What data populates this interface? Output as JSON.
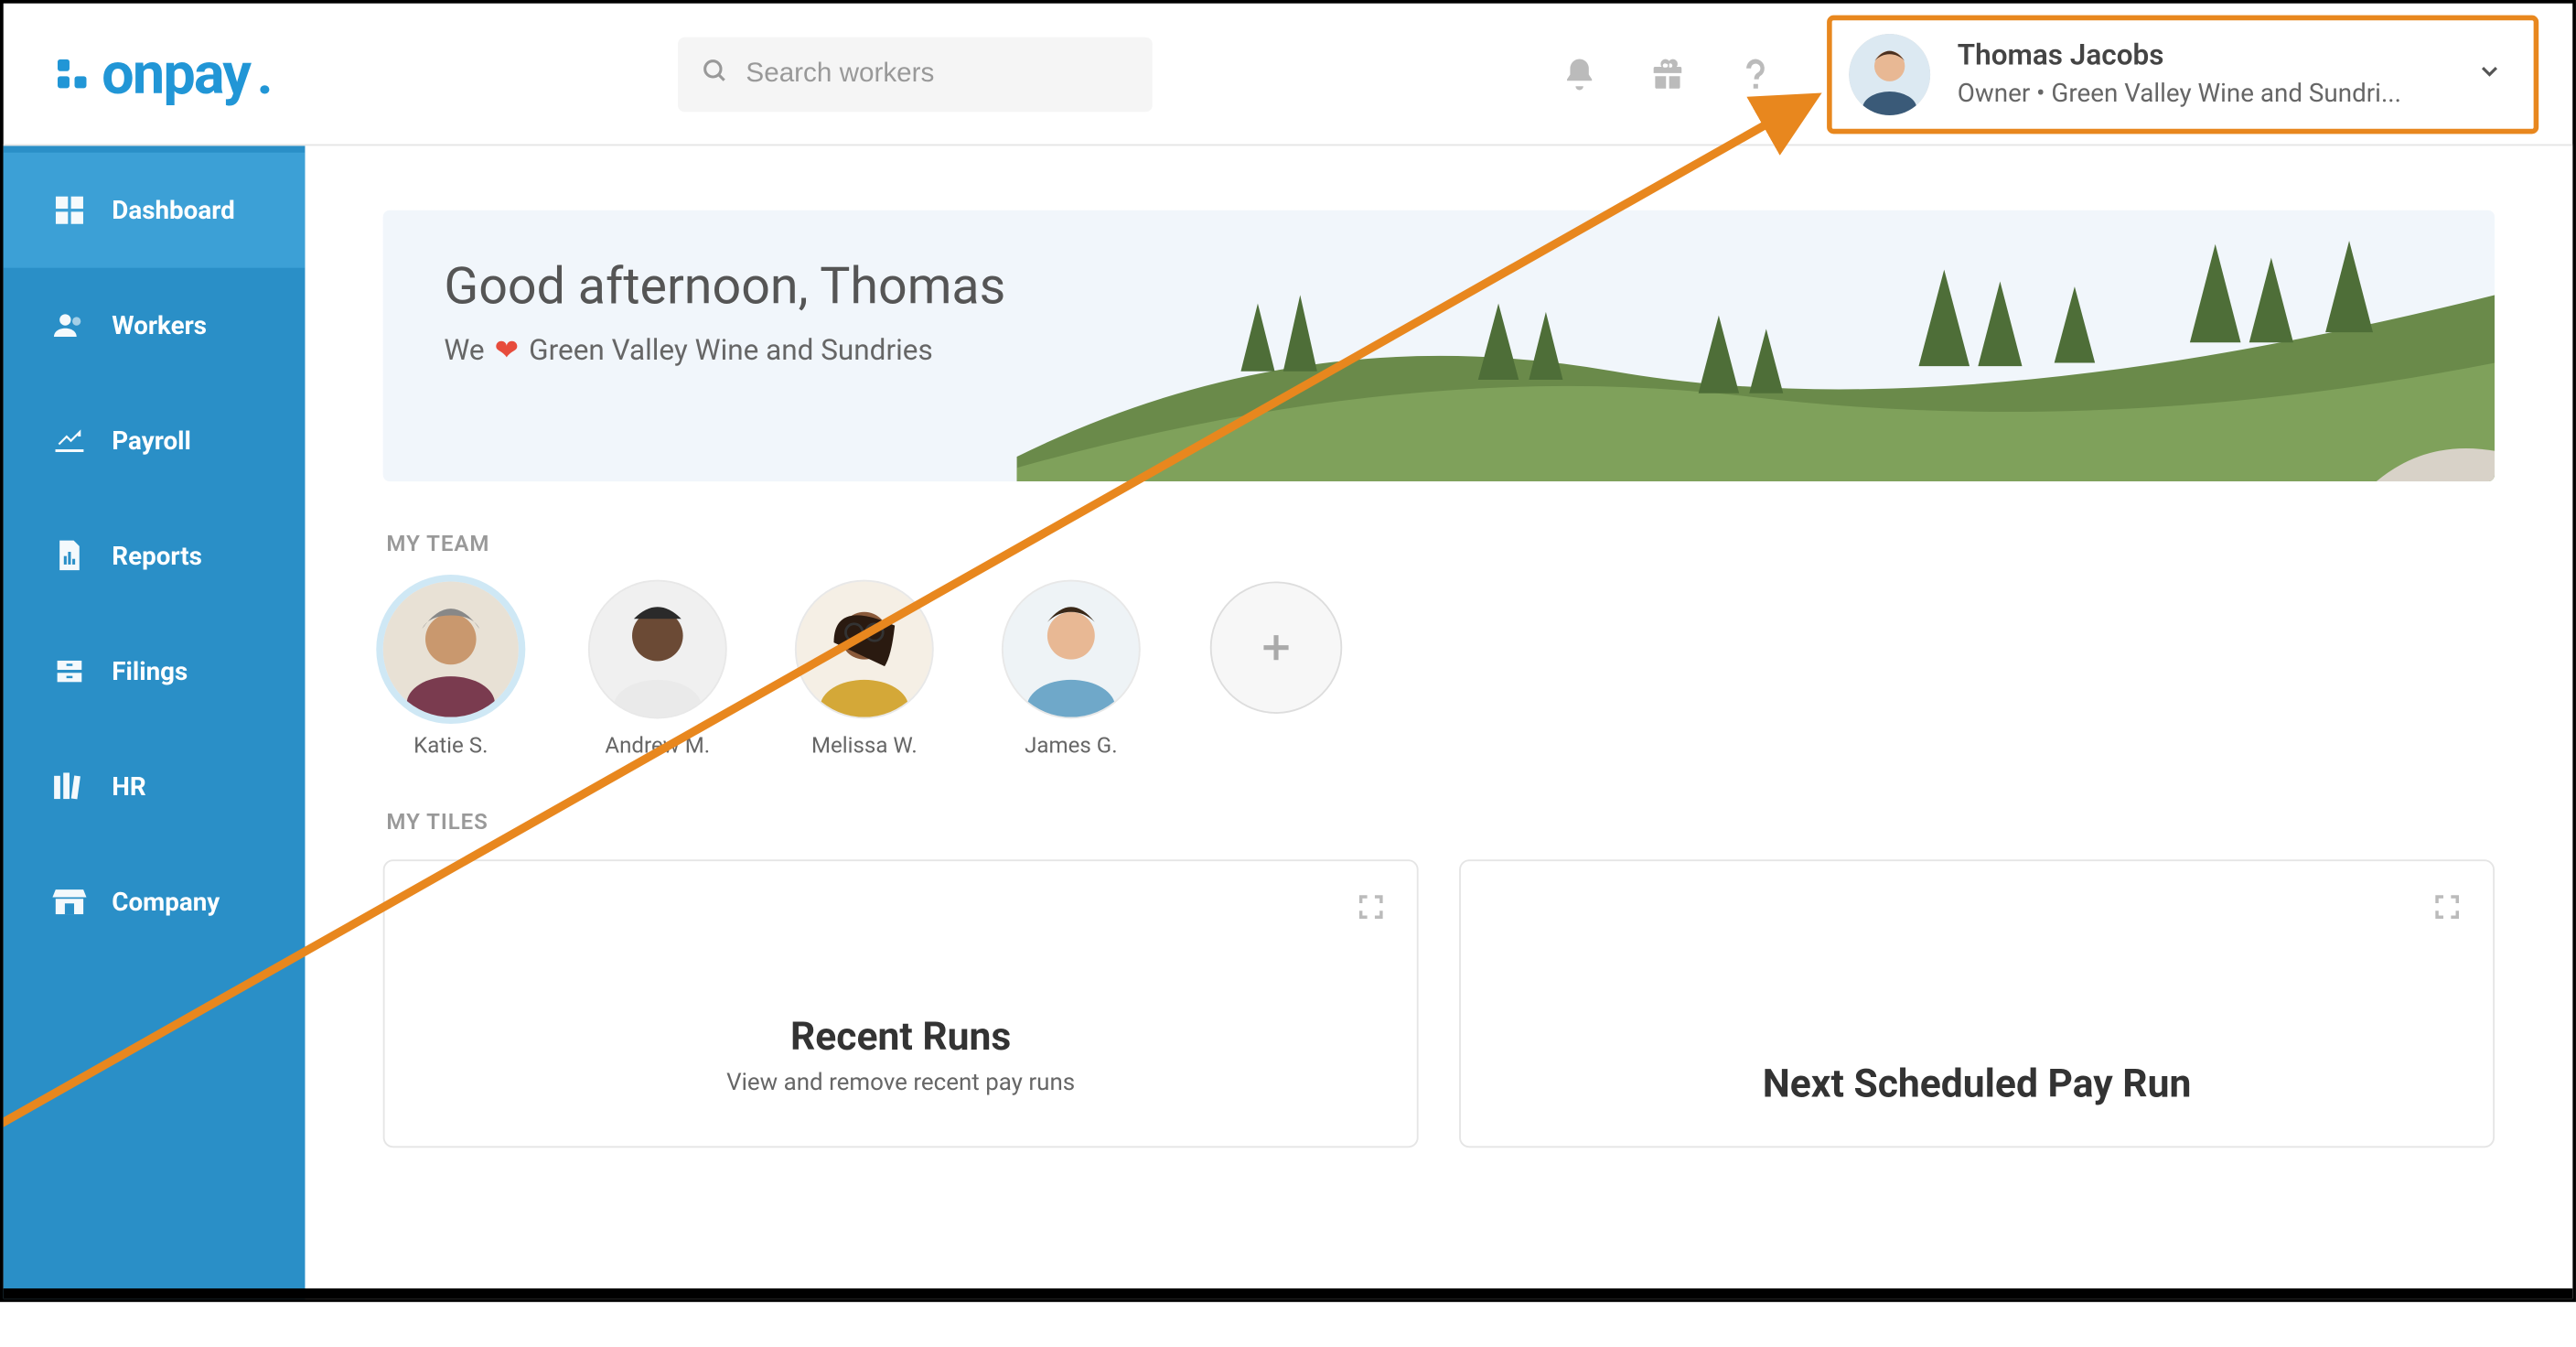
{
  "brand": {
    "name": "onpay"
  },
  "header": {
    "search_placeholder": "Search workers",
    "user_name": "Thomas Jacobs",
    "user_subtitle": "Owner • Green Valley Wine and Sundri..."
  },
  "sidebar": {
    "items": [
      {
        "label": "Dashboard",
        "icon": "grid-icon",
        "active": true
      },
      {
        "label": "Workers",
        "icon": "person-icon",
        "active": false
      },
      {
        "label": "Payroll",
        "icon": "hand-dollar-icon",
        "active": false
      },
      {
        "label": "Reports",
        "icon": "file-chart-icon",
        "active": false
      },
      {
        "label": "Filings",
        "icon": "drawer-icon",
        "active": false
      },
      {
        "label": "HR",
        "icon": "books-icon",
        "active": false
      },
      {
        "label": "Company",
        "icon": "storefront-icon",
        "active": false
      }
    ]
  },
  "hero": {
    "title": "Good afternoon, Thomas",
    "sub_prefix": "We",
    "sub_suffix": "Green Valley Wine and Sundries"
  },
  "sections": {
    "my_team_label": "MY TEAM",
    "my_tiles_label": "MY TILES"
  },
  "team": [
    {
      "name": "Katie S.",
      "selected": true
    },
    {
      "name": "Andrew M.",
      "selected": false
    },
    {
      "name": "Melissa W.",
      "selected": false
    },
    {
      "name": "James G.",
      "selected": false
    }
  ],
  "tiles": [
    {
      "title": "Recent Runs",
      "subtitle": "View and remove recent pay runs"
    },
    {
      "title": "Next Scheduled Pay Run",
      "subtitle": ""
    }
  ],
  "colors": {
    "brand_blue": "#2a8fc7",
    "highlight_orange": "#e8871e"
  }
}
